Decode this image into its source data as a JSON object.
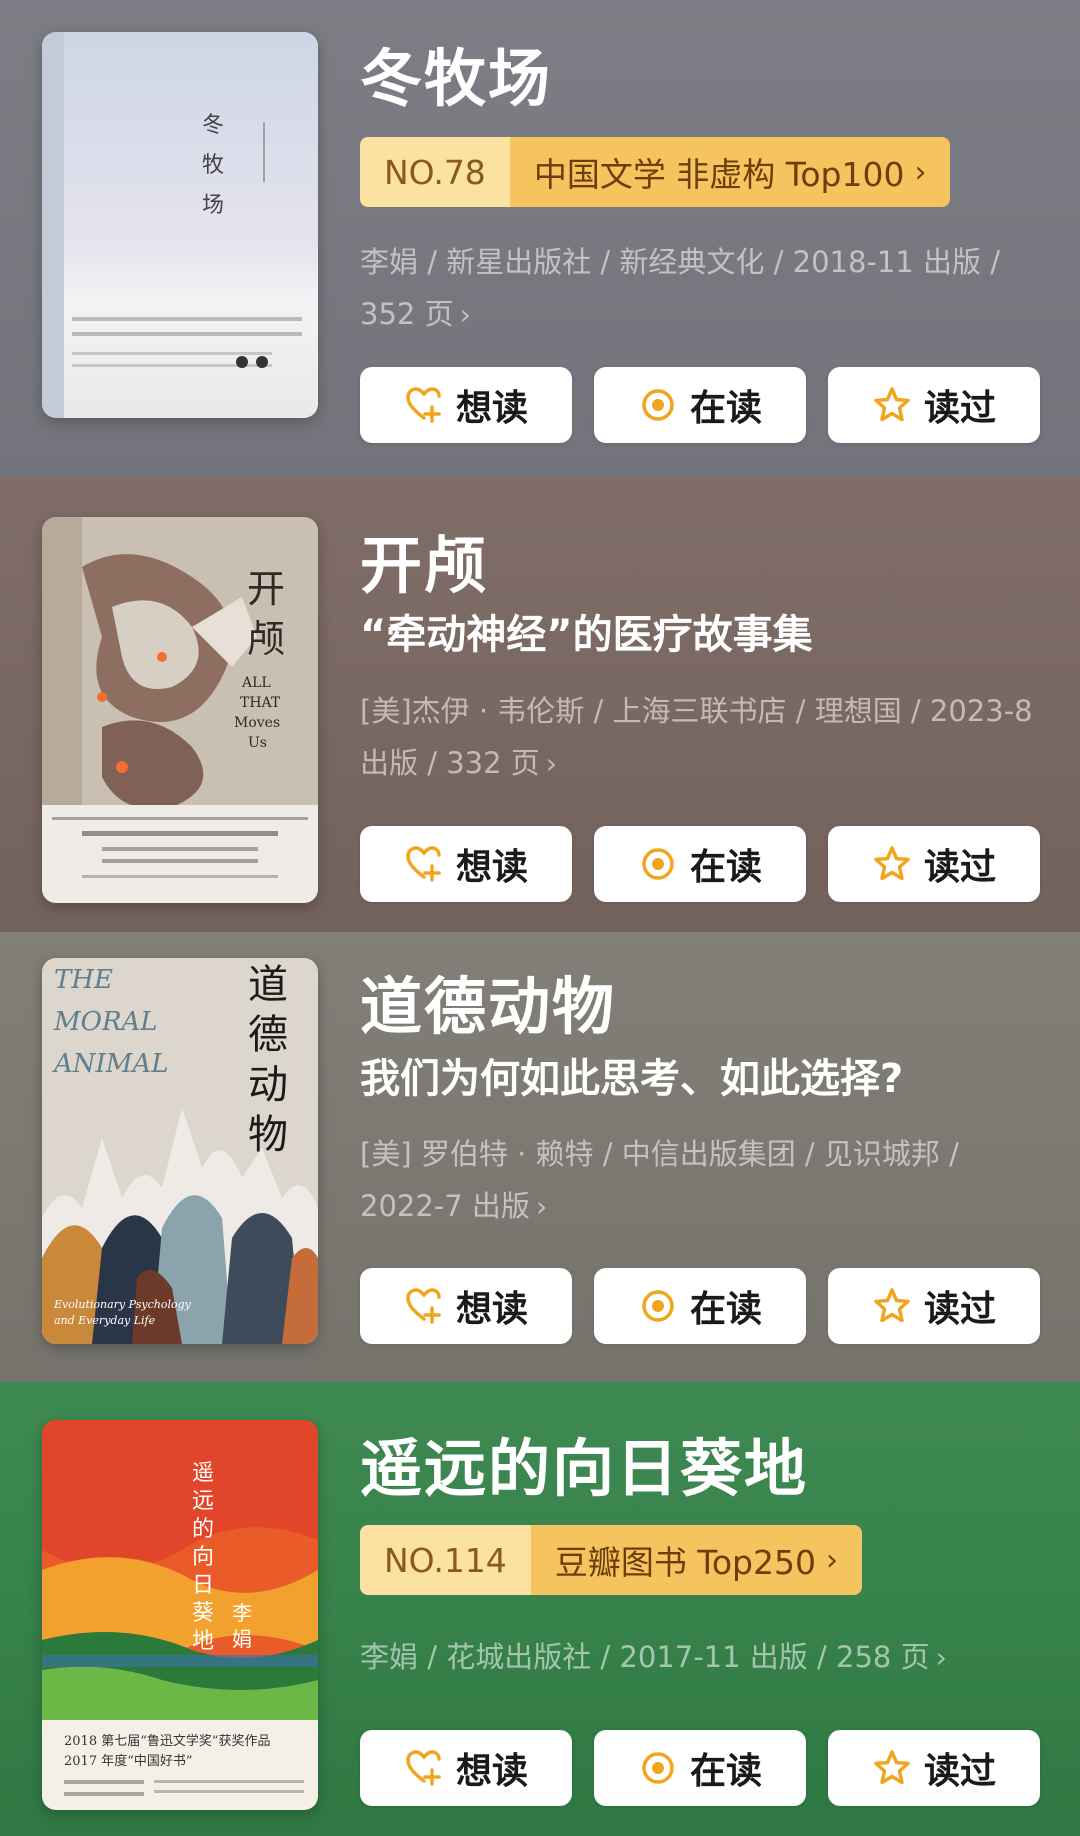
{
  "books": [
    {
      "title": "冬牧场",
      "rank": {
        "no": "NO.78",
        "list": "中国文学 非虚构 Top100",
        "arrow": "›"
      },
      "meta": "李娟 / 新星出版社 / 新经典文化 / 2018-11 出版 / 352 页",
      "cover_text": "冬牧场",
      "actions": {
        "want": "想读",
        "reading": "在读",
        "read": "读过"
      }
    },
    {
      "title": "开颅",
      "subtitle": "“牵动神经”的医疗故事集",
      "meta": "[美]杰伊 · 韦伦斯 / 上海三联书店 / 理想国 / 2023-8 出版 / 332 页",
      "cover_text": "开颅",
      "cover_en": "ALL THAT Moves Us",
      "actions": {
        "want": "想读",
        "reading": "在读",
        "read": "读过"
      }
    },
    {
      "title": "道德动物",
      "subtitle": "我们为何如此思考、如此选择?",
      "meta": "[美] 罗伯特 · 赖特 / 中信出版集团 / 见识城邦 / 2022-7 出版",
      "cover_text": "道德动物",
      "cover_en": "THE MORAL ANIMAL",
      "actions": {
        "want": "想读",
        "reading": "在读",
        "read": "读过"
      }
    },
    {
      "title": "遥远的向日葵地",
      "rank": {
        "no": "NO.114",
        "list": "豆瓣图书 Top250",
        "arrow": "›"
      },
      "meta": "李娟 / 花城出版社 / 2017-11 出版 / 258 页",
      "cover_text": "遥远的向日葵地",
      "cover_author": "李娟",
      "cover_award": "2018 第七届“鲁迅文学奖”获奖作品",
      "actions": {
        "want": "想读",
        "reading": "在读",
        "read": "读过"
      }
    }
  ],
  "chevron": "›",
  "colors": {
    "accent": "#f0a51e",
    "rank_light": "#fbe2a3",
    "rank_dark": "#f6c45e"
  },
  "icons": {
    "want": "heart-plus-icon",
    "reading": "target-icon",
    "read": "star-icon"
  }
}
